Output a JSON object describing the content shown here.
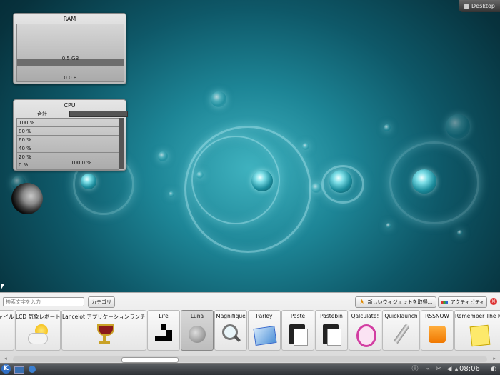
{
  "desktop": {
    "button_label": "Desktop"
  },
  "ram_widget": {
    "title": "RAM",
    "used": "0.5 GB",
    "free": "0.0 B"
  },
  "cpu_widget": {
    "title": "CPU",
    "total_label": "合計",
    "grid_labels": [
      "100 %",
      "80 %",
      "60 %",
      "40 %",
      "20 %",
      "0 %"
    ],
    "current_value": "100.0 %"
  },
  "widget_explorer": {
    "search_placeholder": "検索文字を入力",
    "category_button": "カテゴリ",
    "get_widgets_button": "新しいウィジェットを取得...",
    "activities_button": "アクティビティ",
    "tiles": [
      {
        "label": "ァイル"
      },
      {
        "label": "LCD 気象レポート"
      },
      {
        "label": "Lancelot アプリケーションランチャー"
      },
      {
        "label": "Life"
      },
      {
        "label": "Luna"
      },
      {
        "label": "Magnifique"
      },
      {
        "label": "Parley"
      },
      {
        "label": "Paste"
      },
      {
        "label": "Pastebin"
      },
      {
        "label": "Qalculate!"
      },
      {
        "label": "Quicklaunch"
      },
      {
        "label": "RSSNOW"
      },
      {
        "label": "Remember The Mi"
      }
    ]
  },
  "taskbar": {
    "clock": "08:06"
  }
}
